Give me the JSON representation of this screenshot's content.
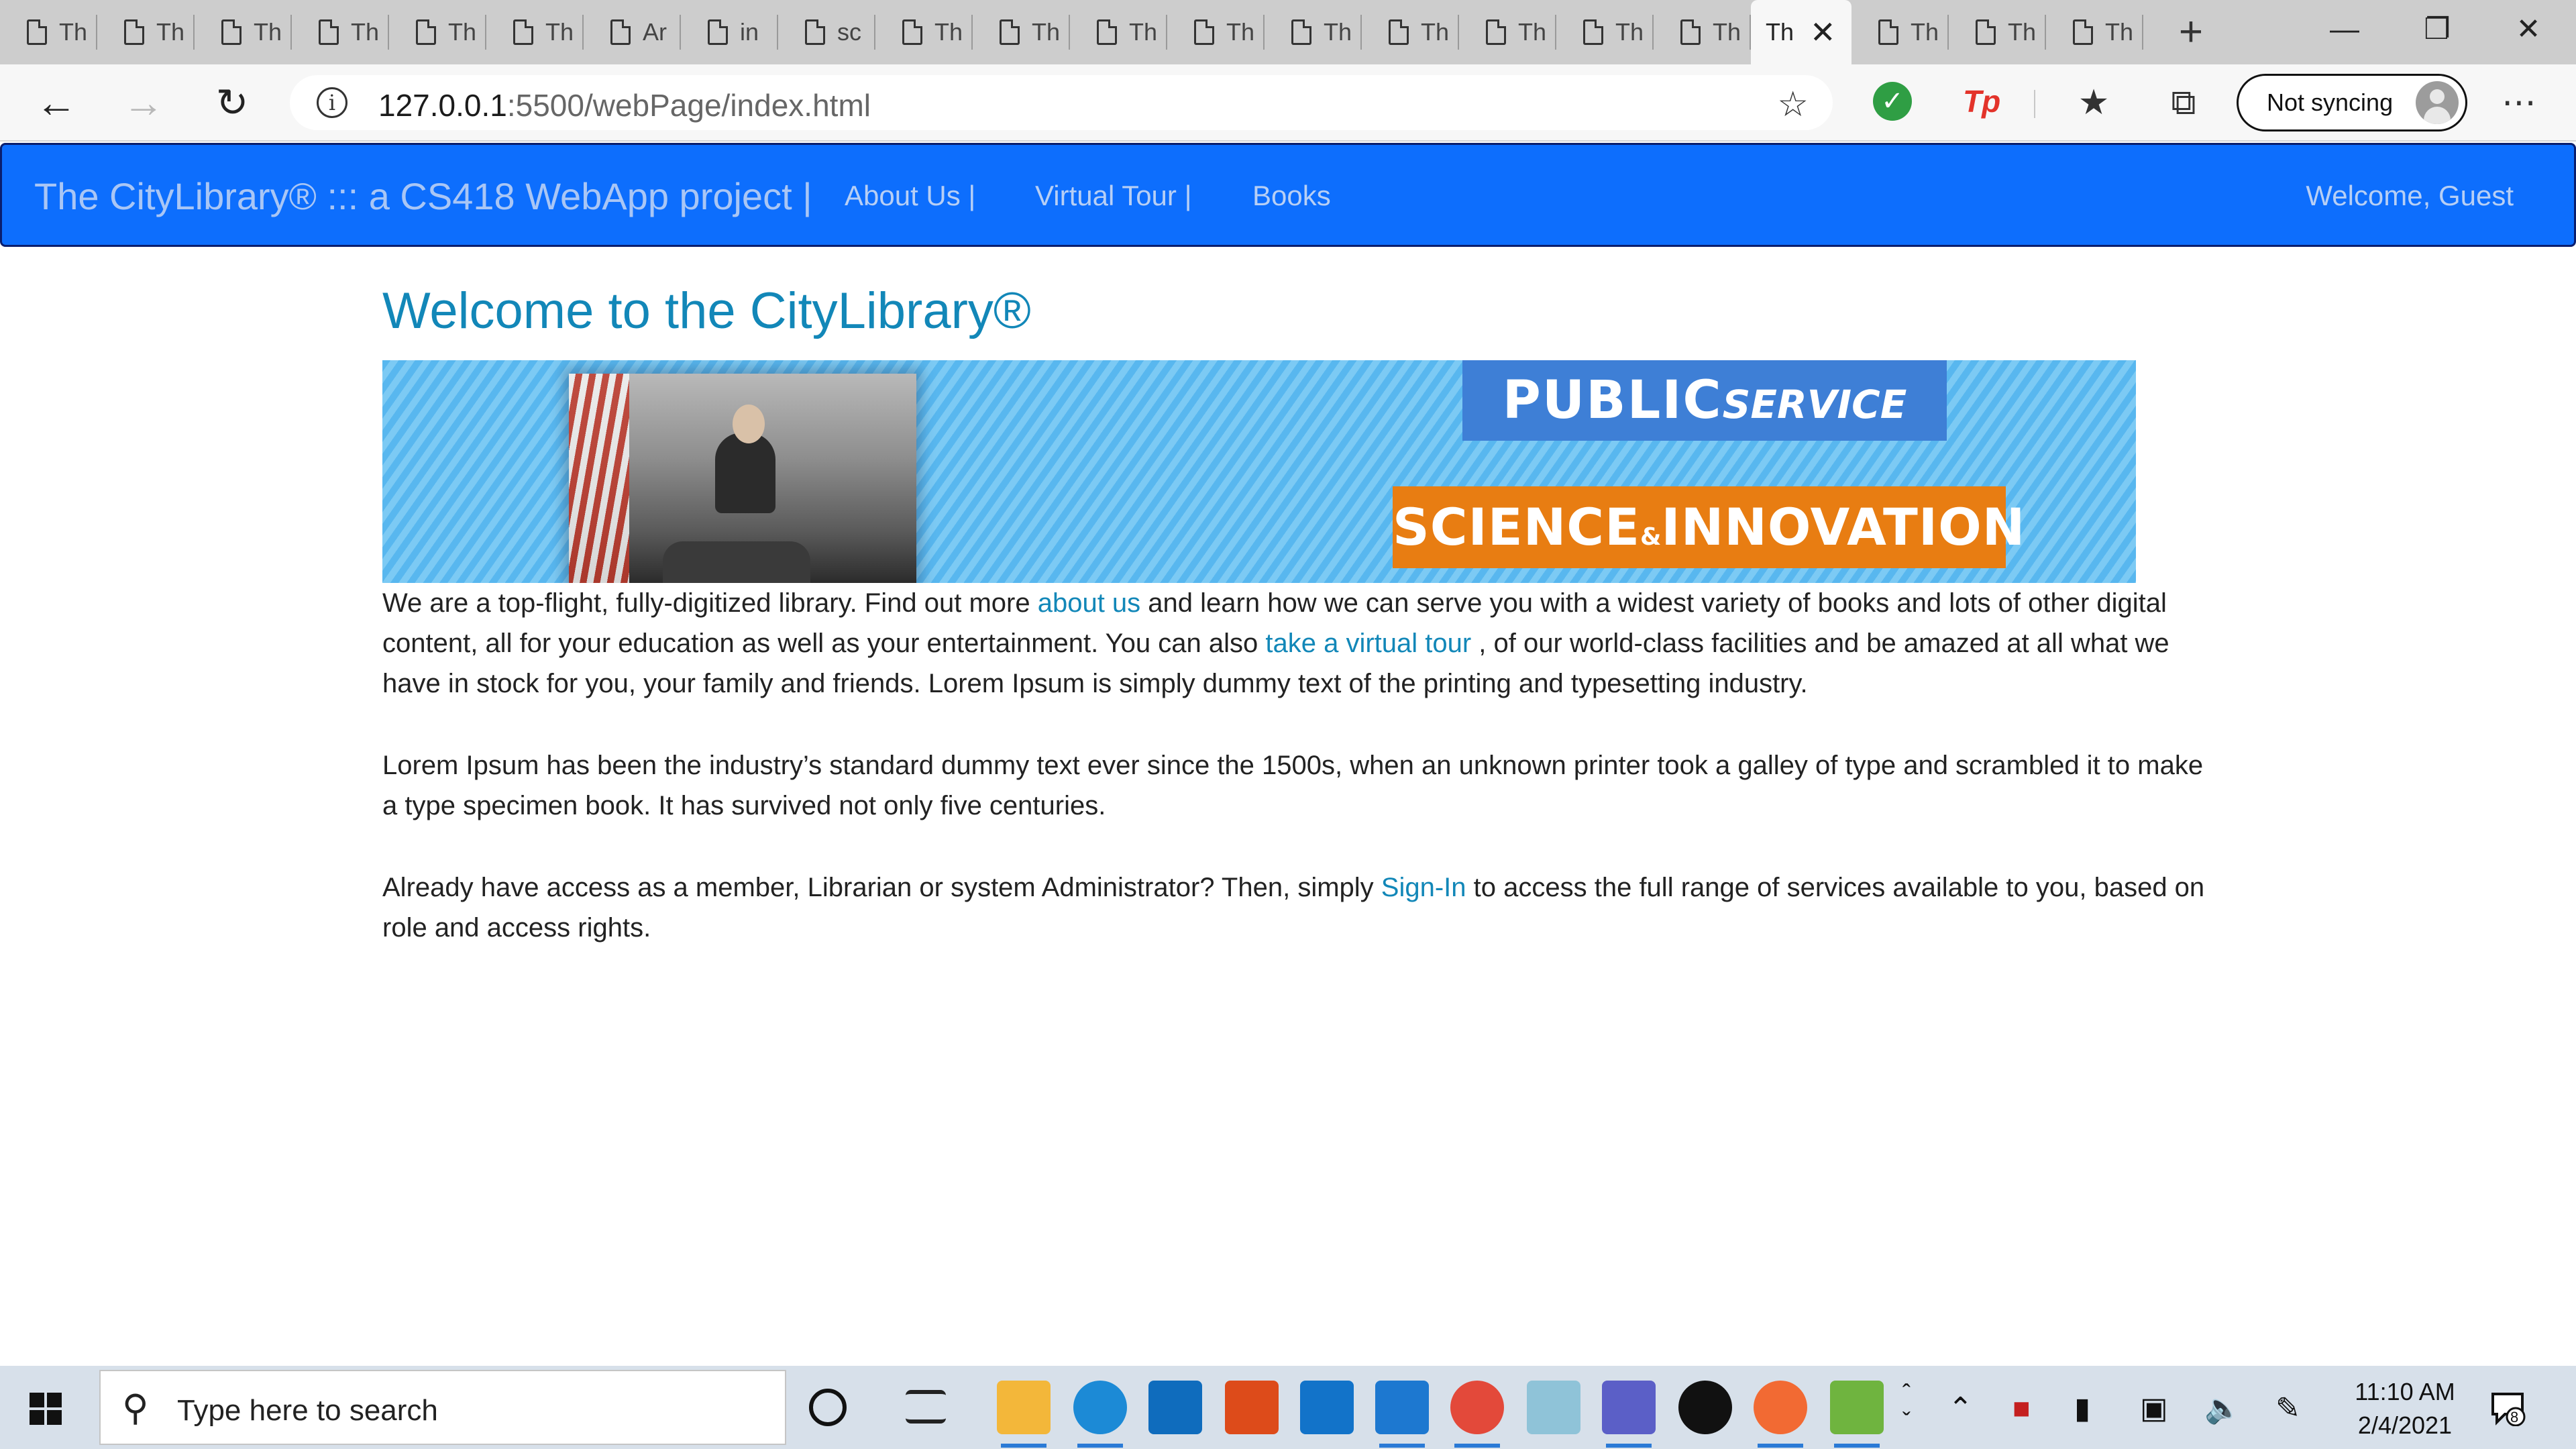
{
  "browser": {
    "tabs": [
      {
        "label": "Th"
      },
      {
        "label": "Th"
      },
      {
        "label": "Th"
      },
      {
        "label": "Th"
      },
      {
        "label": "Th"
      },
      {
        "label": "Th"
      },
      {
        "label": "Ar"
      },
      {
        "label": "in"
      },
      {
        "label": "sc"
      },
      {
        "label": "Th"
      },
      {
        "label": "Th"
      },
      {
        "label": "Th"
      },
      {
        "label": "Th"
      },
      {
        "label": "Th"
      },
      {
        "label": "Th"
      },
      {
        "label": "Th"
      },
      {
        "label": "Th"
      },
      {
        "label": "Th"
      }
    ],
    "active_tab": {
      "label": "Th",
      "close": "✕"
    },
    "tabs_after": [
      {
        "label": "Th"
      },
      {
        "label": "Th"
      },
      {
        "label": "Th"
      }
    ],
    "new_tab": "+",
    "window_controls": {
      "minimize": "—",
      "restore": "❐",
      "close": "✕"
    },
    "address": {
      "host": "127.0.0.1",
      "rest": ":5500/webPage/index.html",
      "info": "i"
    },
    "sync_label": "Not syncing",
    "more": "⋯"
  },
  "site": {
    "brand": "The CityLibrary® ::: a CS418 WebApp project |",
    "nav": {
      "about": "About Us |",
      "tour": "Virtual Tour |",
      "books": "Books"
    },
    "welcome": "Welcome, Guest",
    "title": "Welcome to the CityLibrary®",
    "banner": {
      "public_big": "PUBLIC",
      "public_small": "SERVICE",
      "science_big_1": "SCIENCE",
      "science_amp": "&",
      "science_big_2": "INNOVATION"
    },
    "p1": {
      "t1": "We are a top-flight, fully-digitized library. Find out more ",
      "link1": "about us",
      "t2": " and learn how we can serve you with a widest variety of books and lots of other digital content, all for your education as well as your entertainment. You can also ",
      "link2": "take a virtual tour",
      "t3": " , of our world-class facilities and be amazed at all what we have in stock for you, your family and friends. Lorem Ipsum is simply dummy text of the printing and typesetting industry."
    },
    "p2": "Lorem Ipsum has been the industry’s standard dummy text ever since the 1500s, when an unknown printer took a galley of type and scrambled it to make a type specimen book. It has survived not only five centuries.",
    "p3": {
      "t1": "Already have access as a member, Librarian or system Administrator? Then, simply ",
      "link": "Sign-In",
      "t2": " to access the full range of services available to you, based on role and access rights."
    }
  },
  "taskbar": {
    "search_placeholder": "Type here to search",
    "time": "11:10 AM",
    "date": "2/4/2021",
    "notifications": "8"
  }
}
